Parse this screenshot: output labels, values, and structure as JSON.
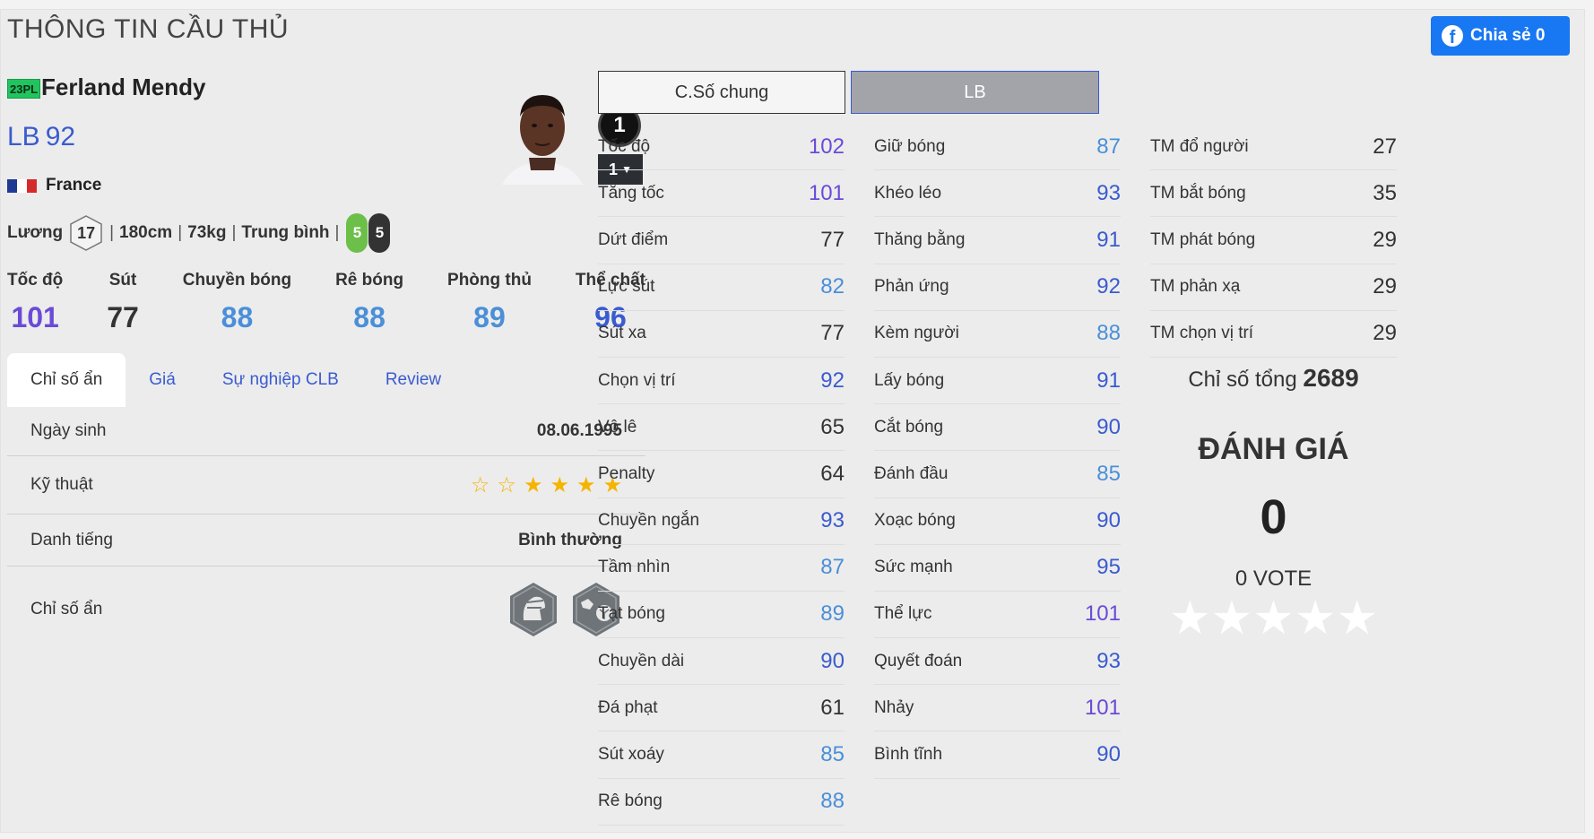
{
  "page_title": "THÔNG TIN CẦU THỦ",
  "share": {
    "label": "Chia sẻ 0",
    "icon": "facebook-icon"
  },
  "player": {
    "season": "23PL",
    "name": "Ferland Mendy",
    "position": "LB",
    "ovr": "92",
    "nation": "France",
    "rank": "1",
    "rank_select": "1"
  },
  "info": {
    "wage_label": "Lương",
    "wage": "17",
    "height": "180cm",
    "weight": "73kg",
    "body": "Trung bình",
    "left_foot": "5",
    "right_foot": "5"
  },
  "main_stats": [
    {
      "label": "Tốc độ",
      "value": "101"
    },
    {
      "label": "Sút",
      "value": "77"
    },
    {
      "label": "Chuyền bóng",
      "value": "88"
    },
    {
      "label": "Rê bóng",
      "value": "88"
    },
    {
      "label": "Phòng thủ",
      "value": "89"
    },
    {
      "label": "Thể chất",
      "value": "96"
    }
  ],
  "tabs": [
    "Chỉ số ẩn",
    "Giá",
    "Sự nghiệp CLB",
    "Review"
  ],
  "details": {
    "birth_label": "Ngày sinh",
    "birth": "08.06.1995",
    "skill_label": "Kỹ thuật",
    "skill_stars": 4,
    "fame_label": "Danh tiếng",
    "fame": "Bình thường",
    "traits_label": "Chỉ số ẩn"
  },
  "toggle": {
    "general": "C.Số chung",
    "position": "LB"
  },
  "stats_col1": [
    {
      "label": "Tốc độ",
      "value": "102"
    },
    {
      "label": "Tăng tốc",
      "value": "101"
    },
    {
      "label": "Dứt điểm",
      "value": "77"
    },
    {
      "label": "Lực sút",
      "value": "82"
    },
    {
      "label": "Sút xa",
      "value": "77"
    },
    {
      "label": "Chọn vị trí",
      "value": "92"
    },
    {
      "label": "Vô lê",
      "value": "65"
    },
    {
      "label": "Penalty",
      "value": "64"
    },
    {
      "label": "Chuyền ngắn",
      "value": "93"
    },
    {
      "label": "Tầm nhìn",
      "value": "87"
    },
    {
      "label": "Tạt bóng",
      "value": "89"
    },
    {
      "label": "Chuyền dài",
      "value": "90"
    },
    {
      "label": "Đá phạt",
      "value": "61"
    },
    {
      "label": "Sút xoáy",
      "value": "85"
    },
    {
      "label": "Rê bóng",
      "value": "88"
    }
  ],
  "stats_col2": [
    {
      "label": "Giữ bóng",
      "value": "87"
    },
    {
      "label": "Khéo léo",
      "value": "93"
    },
    {
      "label": "Thăng bằng",
      "value": "91"
    },
    {
      "label": "Phản ứng",
      "value": "92"
    },
    {
      "label": "Kèm người",
      "value": "88"
    },
    {
      "label": "Lấy bóng",
      "value": "91"
    },
    {
      "label": "Cắt bóng",
      "value": "90"
    },
    {
      "label": "Đánh đầu",
      "value": "85"
    },
    {
      "label": "Xoạc bóng",
      "value": "90"
    },
    {
      "label": "Sức mạnh",
      "value": "95"
    },
    {
      "label": "Thể lực",
      "value": "101"
    },
    {
      "label": "Quyết đoán",
      "value": "93"
    },
    {
      "label": "Nhảy",
      "value": "101"
    },
    {
      "label": "Bình tĩnh",
      "value": "90"
    }
  ],
  "stats_col3": [
    {
      "label": "TM đổ người",
      "value": "27"
    },
    {
      "label": "TM bắt bóng",
      "value": "35"
    },
    {
      "label": "TM phát bóng",
      "value": "29"
    },
    {
      "label": "TM phản xạ",
      "value": "29"
    },
    {
      "label": "TM chọn vị trí",
      "value": "29"
    }
  ],
  "total": {
    "label": "Chỉ số tổng",
    "value": "2689"
  },
  "rating": {
    "title": "ĐÁNH GIÁ",
    "score": "0",
    "votes": "0 VOTE"
  },
  "colors": {
    "tier_120": "#9b59ff",
    "tier_100": "#6a4ad8",
    "tier_90": "#3a5bcf",
    "tier_80": "#4a8fd8",
    "tier_70": "#333333",
    "accent": "#3a5bcf",
    "facebook": "#1877f2",
    "star_gold": "#f5b400",
    "left_foot": "#6cc04a",
    "right_foot": "#333333"
  }
}
